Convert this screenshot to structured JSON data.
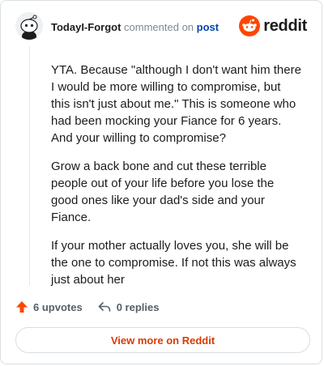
{
  "comment": {
    "username": "TodayI-Forgot",
    "action_text": "commented on",
    "post_link": "post",
    "paragraphs": [
      "YTA. Because \"although I don't want him there I would be more willing to compromise, but this isn't just about me.\" This is someone who had been mocking your Fiance for 6 years. And your willing to compromise?",
      "Grow a back bone and cut these terrible people out of your life before you lose the good ones like your dad's side and your Fiance.",
      "If your mother actually loves you, she will be the one to compromise. If not this was always just about her"
    ],
    "upvotes": "6 upvotes",
    "replies": "0 replies"
  },
  "brand": {
    "wordmark": "reddit",
    "accent": "#ff4500"
  },
  "footer": {
    "view_more": "View more on Reddit"
  }
}
